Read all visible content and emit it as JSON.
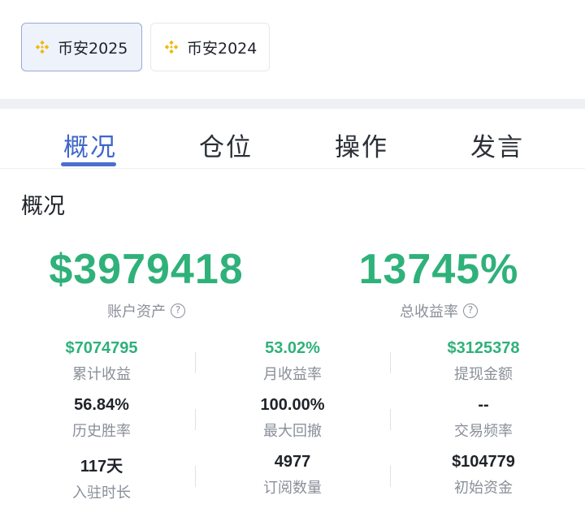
{
  "chips": [
    {
      "label": "币安2025",
      "active": true
    },
    {
      "label": "币安2024",
      "active": false
    }
  ],
  "tabs": [
    {
      "label": "概况"
    },
    {
      "label": "仓位"
    },
    {
      "label": "操作"
    },
    {
      "label": "发言"
    }
  ],
  "section_title": "概况",
  "summary": {
    "account_asset": {
      "value": "$3979418",
      "label": "账户资产"
    },
    "total_return": {
      "value": "13745%",
      "label": "总收益率"
    }
  },
  "stats": [
    [
      {
        "value": "$7074795",
        "label": "累计收益",
        "highlight": true
      },
      {
        "value": "53.02%",
        "label": "月收益率",
        "highlight": true
      },
      {
        "value": "$3125378",
        "label": "提现金额",
        "highlight": true
      }
    ],
    [
      {
        "value": "56.84%",
        "label": "历史胜率",
        "highlight": false
      },
      {
        "value": "100.00%",
        "label": "最大回撤",
        "highlight": false
      },
      {
        "value": "--",
        "label": "交易频率",
        "highlight": false
      }
    ],
    [
      {
        "value": "117天",
        "label": "入驻时长",
        "highlight": false
      },
      {
        "value": "4977",
        "label": "订阅数量",
        "highlight": false
      },
      {
        "value": "$104779",
        "label": "初始资金",
        "highlight": false
      }
    ]
  ],
  "colors": {
    "accent": "#4a6fd0",
    "positive": "#2fb17a",
    "brand": "#f0b90b"
  },
  "icons": {
    "chip_logo": "binance-logo-icon",
    "help": "help-circle-icon"
  }
}
